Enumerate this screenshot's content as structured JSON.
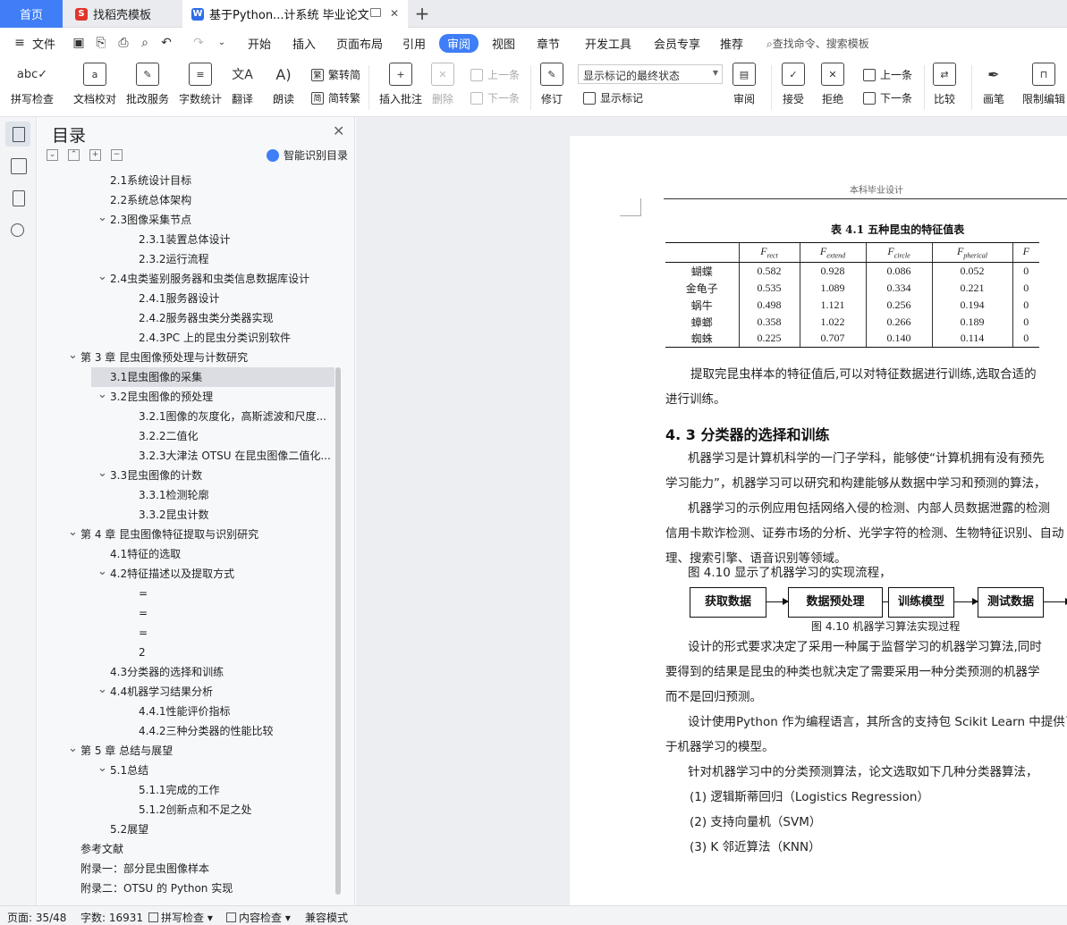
{
  "tabs": {
    "home": "首页",
    "template": "找稻壳模板",
    "doc": "基于Python...计系统 毕业论文"
  },
  "menu": {
    "file": "文件",
    "items": [
      "开始",
      "插入",
      "页面布局",
      "引用",
      "审阅",
      "视图",
      "章节",
      "开发工具",
      "会员专享",
      "推荐"
    ],
    "active": "审阅",
    "search": "查找命令、搜索模板"
  },
  "ribbon": {
    "spellcheck": "拼写检查",
    "doc_proof": "文档校对",
    "batch_service": "批改服务",
    "word_count": "字数统计",
    "translate": "翻译",
    "read_aloud": "朗读",
    "to_traditional": "繁转简",
    "to_simplified": "简转繁",
    "insert_comment": "插入批注",
    "delete": "删除",
    "prev_comment": "上一条",
    "next_comment": "下一条",
    "track_changes": "修订",
    "markup_state": "显示标记的最终状态",
    "show_markup": "显示标记",
    "review": "审阅",
    "accept": "接受",
    "reject": "拒绝",
    "prev_change": "上一条",
    "next_change": "下一条",
    "compare": "比较",
    "pen": "画笔",
    "restrict_edit": "限制编辑"
  },
  "toc": {
    "title": "目录",
    "smart": "智能识别目录",
    "items": [
      {
        "text": "2.1系统设计目标",
        "level": 2,
        "toggle": ""
      },
      {
        "text": "2.2系统总体架构",
        "level": 2,
        "toggle": ""
      },
      {
        "text": "2.3图像采集节点",
        "level": 2,
        "toggle": "v"
      },
      {
        "text": "2.3.1装置总体设计",
        "level": 3,
        "toggle": ""
      },
      {
        "text": "2.3.2运行流程",
        "level": 3,
        "toggle": ""
      },
      {
        "text": "2.4虫类鉴别服务器和虫类信息数据库设计",
        "level": 2,
        "toggle": "v"
      },
      {
        "text": "2.4.1服务器设计",
        "level": 3,
        "toggle": ""
      },
      {
        "text": "2.4.2服务器虫类分类器实现",
        "level": 3,
        "toggle": ""
      },
      {
        "text": "2.4.3PC 上的昆虫分类识别软件",
        "level": 3,
        "toggle": ""
      },
      {
        "text": "第 3 章 昆虫图像预处理与计数研究",
        "level": 1,
        "toggle": "v"
      },
      {
        "text": "3.1昆虫图像的采集",
        "level": 2,
        "toggle": "",
        "selected": true
      },
      {
        "text": "3.2昆虫图像的预处理",
        "level": 2,
        "toggle": "v"
      },
      {
        "text": "3.2.1图像的灰度化，高斯滤波和尺度...",
        "level": 3,
        "toggle": ""
      },
      {
        "text": "3.2.2二值化",
        "level": 3,
        "toggle": ""
      },
      {
        "text": "3.2.3大津法 OTSU 在昆虫图像二值化...",
        "level": 3,
        "toggle": ""
      },
      {
        "text": "3.3昆虫图像的计数",
        "level": 2,
        "toggle": "v"
      },
      {
        "text": "3.3.1检测轮廓",
        "level": 3,
        "toggle": ""
      },
      {
        "text": "3.3.2昆虫计数",
        "level": 3,
        "toggle": ""
      },
      {
        "text": "第 4 章 昆虫图像特征提取与识别研究",
        "level": 1,
        "toggle": "v"
      },
      {
        "text": "4.1特征的选取",
        "level": 2,
        "toggle": ""
      },
      {
        "text": "4.2特征描述以及提取方式",
        "level": 2,
        "toggle": "v"
      },
      {
        "text": "=",
        "level": 3,
        "toggle": ""
      },
      {
        "text": "=",
        "level": 3,
        "toggle": ""
      },
      {
        "text": "=",
        "level": 3,
        "toggle": ""
      },
      {
        "text": "2",
        "level": 3,
        "toggle": ""
      },
      {
        "text": "4.3分类器的选择和训练",
        "level": 2,
        "toggle": ""
      },
      {
        "text": "4.4机器学习结果分析",
        "level": 2,
        "toggle": "v"
      },
      {
        "text": "4.4.1性能评价指标",
        "level": 3,
        "toggle": ""
      },
      {
        "text": "4.4.2三种分类器的性能比较",
        "level": 3,
        "toggle": ""
      },
      {
        "text": "第 5 章 总结与展望",
        "level": 1,
        "toggle": "v"
      },
      {
        "text": "5.1总结",
        "level": 2,
        "toggle": "v"
      },
      {
        "text": "5.1.1完成的工作",
        "level": 3,
        "toggle": ""
      },
      {
        "text": "5.1.2创新点和不足之处",
        "level": 3,
        "toggle": ""
      },
      {
        "text": "5.2展望",
        "level": 2,
        "toggle": ""
      },
      {
        "text": "参考文献",
        "level": 1,
        "toggle": ""
      },
      {
        "text": "附录一：部分昆虫图像样本",
        "level": 1,
        "toggle": ""
      },
      {
        "text": "附录二：OTSU 的 Python 实现",
        "level": 1,
        "toggle": ""
      }
    ]
  },
  "doc": {
    "header": "本科毕业设计",
    "table_caption": "表 4.1 五种昆虫的特征值表",
    "table_cols": [
      {
        "base": "F",
        "sub": "rect"
      },
      {
        "base": "F",
        "sub": "extend"
      },
      {
        "base": "F",
        "sub": "circle"
      },
      {
        "base": "F",
        "sub": "pherical"
      },
      {
        "base": "F",
        "sub": ""
      }
    ],
    "table_rows": [
      [
        "蝴蝶",
        "0.582",
        "0.928",
        "0.086",
        "0.052",
        "0"
      ],
      [
        "金龟子",
        "0.535",
        "1.089",
        "0.334",
        "0.221",
        "0"
      ],
      [
        "蜗牛",
        "0.498",
        "1.121",
        "0.256",
        "0.194",
        "0"
      ],
      [
        "蟑螂",
        "0.358",
        "1.022",
        "0.266",
        "0.189",
        "0"
      ],
      [
        "蜘蛛",
        "0.225",
        "0.707",
        "0.140",
        "0.114",
        "0"
      ]
    ],
    "p1a": "提取完昆虫样本的特征值后,可以对特征数据进行训练,选取合适的",
    "p1b": "进行训练。",
    "section": "4. 3 分类器的选择和训练",
    "p2a": "机器学习是计算机科学的一门子学科，能够使“计算机拥有没有预先",
    "p2b": "学习能力”，机器学习可以研究和构建能够从数据中学习和预测的算法，",
    "p3a": "机器学习的示例应用包括网络入侵的检测、内部人员数据泄露的检测",
    "p3b": "信用卡欺诈检测、证券市场的分析、光学字符的检测、生物特征识别、自动",
    "p3c": "理、搜索引擎、语音识别等领域。",
    "p4": "图 4.10 显示了机器学习的实现流程，",
    "flow": [
      "获取数据",
      "数据预处理",
      "训练模型",
      "测试数据"
    ],
    "flow_caption": "图 4.10 机器学习算法实现过程",
    "p5a": "设计的形式要求决定了采用一种属于监督学习的机器学习算法,同时",
    "p5b": "要得到的结果是昆虫的种类也就决定了需要采用一种分类预测的机器学",
    "p5c": "而不是回归预测。",
    "p6a": "设计使用Python 作为编程语言，其所含的支持包 Scikit Learn 中提供了",
    "p6b": "于机器学习的模型。",
    "p7": "针对机器学习中的分类预测算法，论文选取如下几种分类器算法，",
    "li1": "(1) 逻辑斯蒂回归（Logistics Regression）",
    "li2": "(2) 支持向量机（SVM）",
    "li3": "(3) K 邻近算法（KNN）"
  },
  "status": {
    "page": "页面: 35/48",
    "words": "字数: 16931",
    "spell": "拼写检查",
    "content_check": "内容检查",
    "compat": "兼容模式"
  }
}
